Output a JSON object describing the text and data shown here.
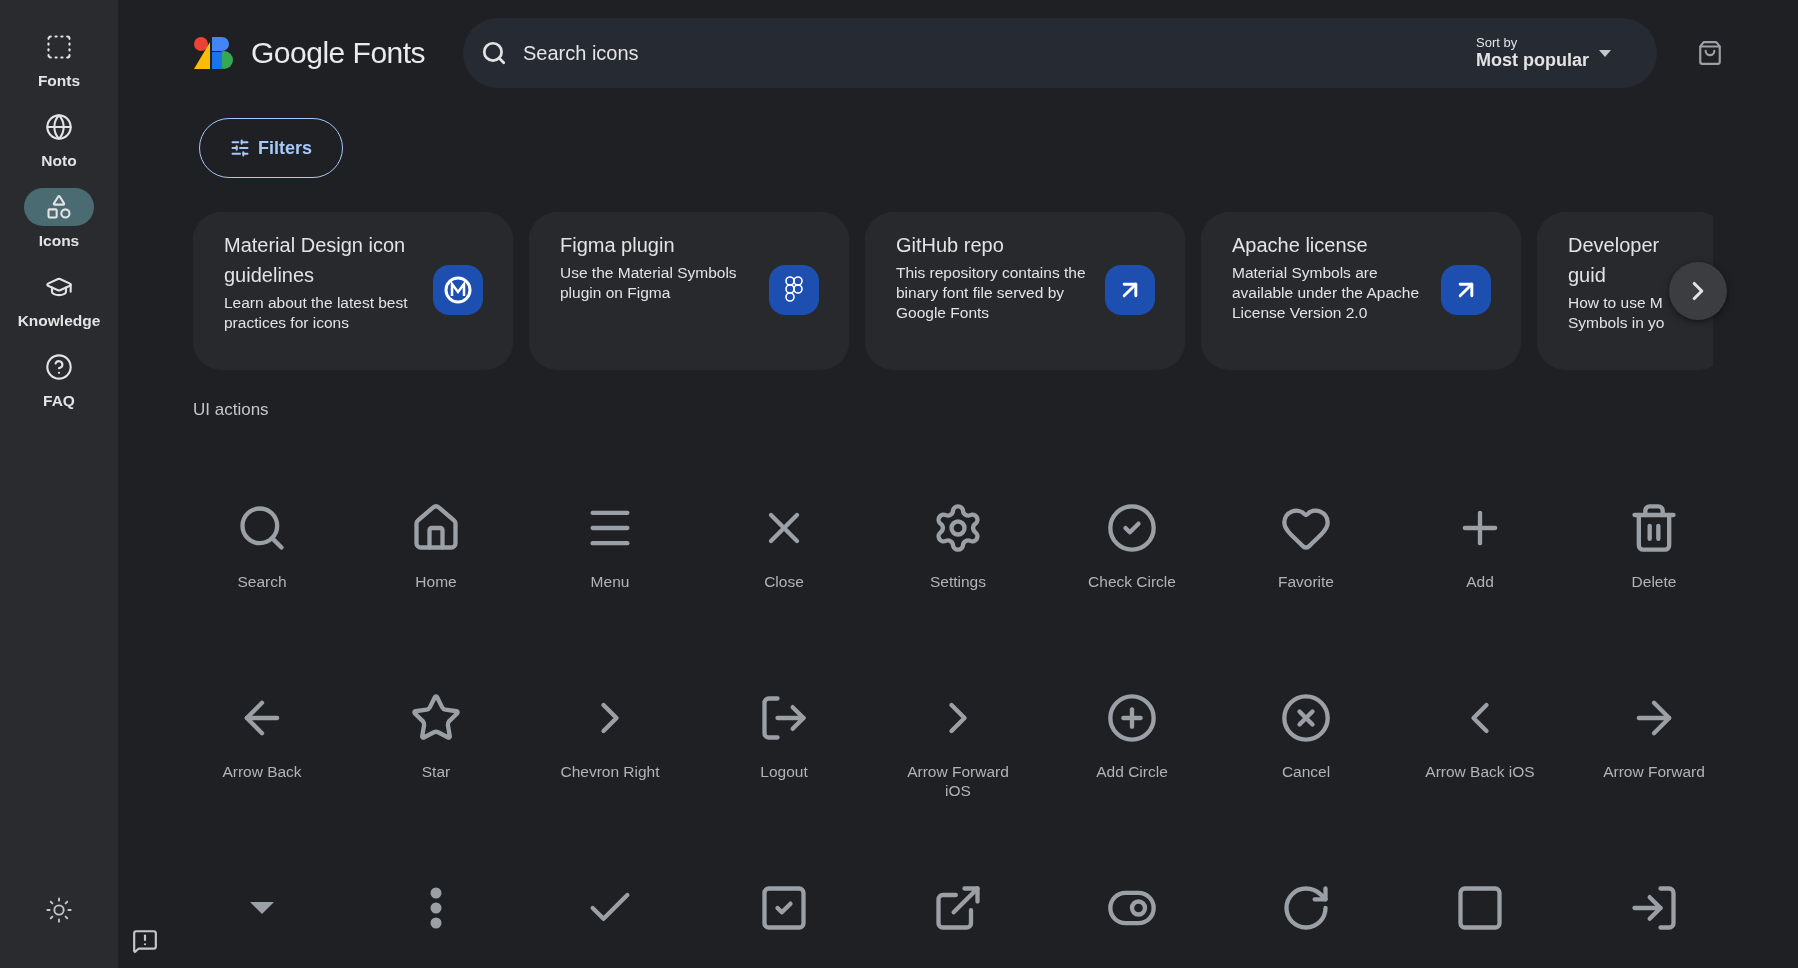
{
  "sidebar": {
    "items": [
      {
        "label": "Fonts",
        "selected": false
      },
      {
        "label": "Noto",
        "selected": false
      },
      {
        "label": "Icons",
        "selected": true
      },
      {
        "label": "Knowledge",
        "selected": false
      },
      {
        "label": "FAQ",
        "selected": false
      }
    ]
  },
  "header": {
    "brand": "Google Fonts",
    "search": {
      "placeholder": "Search icons"
    },
    "sort": {
      "label": "Sort by",
      "value": "Most popular"
    }
  },
  "filters_button": "Filters",
  "cards": [
    {
      "kind": "guidelines",
      "title": "Material Design icon guidelines",
      "description": "Learn about the latest best practices for icons"
    },
    {
      "kind": "figma",
      "title": "Figma plugin",
      "description": "Use the Material Symbols plugin on Figma"
    },
    {
      "kind": "link",
      "title": "GitHub repo",
      "description": "This repository contains the binary font file served by Google Fonts"
    },
    {
      "kind": "link",
      "title": "Apache license",
      "description": "Material Symbols are available under the Apache License Version 2.0"
    },
    {
      "kind": "cut",
      "title": "Developer guid",
      "description": "How to use M\nSymbols in yo"
    }
  ],
  "section_title": "UI actions",
  "icons": [
    {
      "kind": "labeled",
      "label": "Search"
    },
    {
      "kind": "labeled",
      "label": "Home"
    },
    {
      "kind": "labeled",
      "label": "Menu"
    },
    {
      "kind": "labeled",
      "label": "Close"
    },
    {
      "kind": "labeled",
      "label": "Settings"
    },
    {
      "kind": "labeled",
      "label": "Check Circle"
    },
    {
      "kind": "labeled",
      "label": "Favorite"
    },
    {
      "kind": "labeled",
      "label": "Add"
    },
    {
      "kind": "labeled",
      "label": "Delete"
    },
    {
      "kind": "labeled",
      "label": "Arrow Back"
    },
    {
      "kind": "labeled",
      "label": "Star"
    },
    {
      "kind": "labeled",
      "label": "Chevron Right"
    },
    {
      "kind": "labeled",
      "label": "Logout"
    },
    {
      "kind": "labeled",
      "label": "Arrow Forward iOS"
    },
    {
      "kind": "labeled",
      "label": "Add Circle"
    },
    {
      "kind": "labeled",
      "label": "Cancel"
    },
    {
      "kind": "labeled",
      "label": "Arrow Back iOS"
    },
    {
      "kind": "labeled",
      "label": "Arrow Forward"
    },
    {
      "kind": "unlabeled"
    },
    {
      "kind": "unlabeled"
    },
    {
      "kind": "unlabeled"
    },
    {
      "kind": "unlabeled"
    },
    {
      "kind": "unlabeled"
    },
    {
      "kind": "unlabeled"
    },
    {
      "kind": "unlabeled"
    },
    {
      "kind": "unlabeled"
    },
    {
      "kind": "unlabeled"
    }
  ]
}
